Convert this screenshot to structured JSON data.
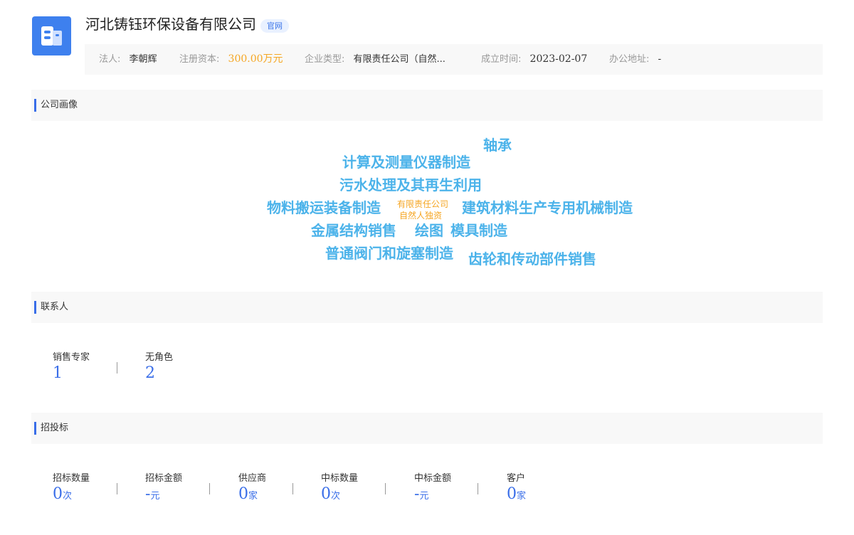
{
  "company": {
    "name": "河北铸钰环保设备有限公司",
    "official_site_badge": "官网",
    "logo_icon": "building-icon"
  },
  "info": {
    "legal_label": "法人:",
    "legal_value": "李朝辉",
    "capital_label": "注册资本:",
    "capital_value": "300.00万元",
    "type_label": "企业类型:",
    "type_value": "有限责任公司（自然...",
    "founded_label": "成立时间:",
    "founded_value": "2023-02-07",
    "address_label": "办公地址:",
    "address_value": "-"
  },
  "sections": {
    "portrait": "公司画像",
    "contacts": "联系人",
    "bidding": "招投标"
  },
  "portrait_cloud": {
    "tags": [
      "轴承",
      "计算及测量仪器制造",
      "污水处理及其再生利用",
      "物料搬运装备制造",
      "建筑材料生产专用机械制造",
      "金属结构销售",
      "绘图",
      "模具制造",
      "普通阀门和旋塞制造",
      "齿轮和传动部件销售"
    ],
    "core_line1": "有限责任公司",
    "core_line2": "自然人独资",
    "tag_color": "#4cb3ea",
    "core_color": "#f5a623"
  },
  "contacts": [
    {
      "label": "销售专家",
      "value": "1"
    },
    {
      "label": "无角色",
      "value": "2"
    }
  ],
  "bidding": [
    {
      "label": "招标数量",
      "value": "0",
      "unit": "次"
    },
    {
      "label": "招标金额",
      "value": "-",
      "unit": "元"
    },
    {
      "label": "供应商",
      "value": "0",
      "unit": "家"
    },
    {
      "label": "中标数量",
      "value": "0",
      "unit": "次"
    },
    {
      "label": "中标金额",
      "value": "-",
      "unit": "元"
    },
    {
      "label": "客户",
      "value": "0",
      "unit": "家"
    }
  ]
}
